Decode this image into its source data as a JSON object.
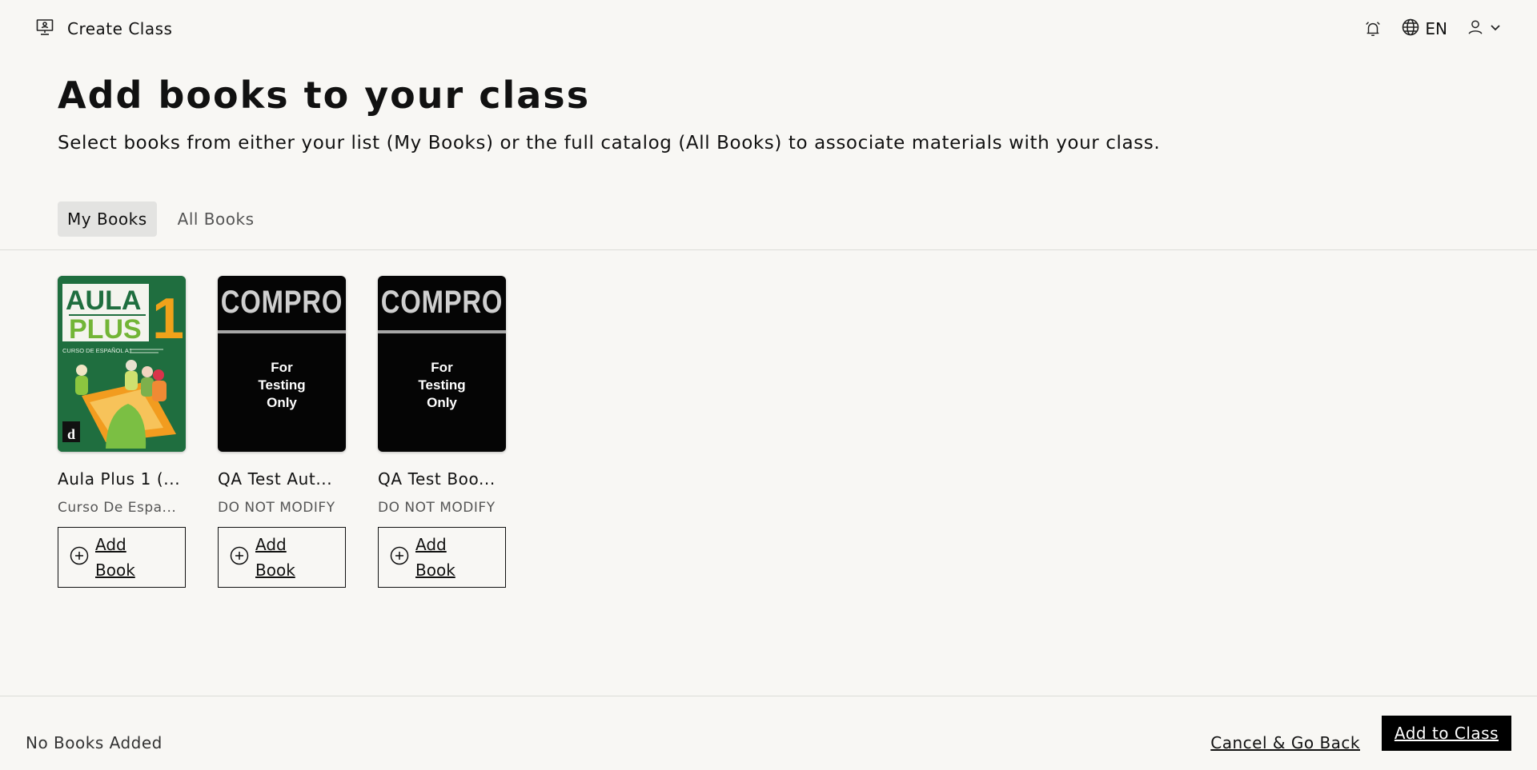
{
  "header": {
    "title": "Create Class",
    "language": "EN",
    "icons": [
      "presentation-icon",
      "alarm-icon",
      "globe-icon",
      "user-icon",
      "chevron-down-icon"
    ]
  },
  "hero": {
    "title": "Add books to your class",
    "subtitle": "Select books from either your list (My Books) or the full catalog (All Books) to associate materials with your class."
  },
  "tabs": [
    {
      "label": "My Books",
      "active": true
    },
    {
      "label": "All Books",
      "active": false
    }
  ],
  "books": [
    {
      "title": "Aula Plus 1 (...",
      "subtitle": "Curso De Espa...",
      "add_label": "Add Book",
      "cover": {
        "word1": "AULA",
        "word2": "PLUS",
        "number": "1",
        "caption": "CURSO DE ESPAÑOL A1",
        "publisher_mark": "d"
      }
    },
    {
      "title": "QA Test Aut...",
      "subtitle": "DO NOT MODIFY",
      "add_label": "Add Book",
      "cover": {
        "brand": "COMPRO",
        "text": "For\nTesting\nOnly"
      }
    },
    {
      "title": "QA Test Boo...",
      "subtitle": "DO NOT MODIFY",
      "add_label": "Add Book",
      "cover": {
        "brand": "COMPRO",
        "text": "For\nTesting\nOnly"
      }
    }
  ],
  "footer": {
    "status": "No Books Added",
    "cancel_label": "Cancel & Go Back",
    "submit_label": "Add to Class"
  },
  "colors": {
    "background": "#f8f7f4",
    "primary_button": "#000000",
    "active_tab": "#e3e3e1",
    "aula_green": "#1f6e3f"
  }
}
